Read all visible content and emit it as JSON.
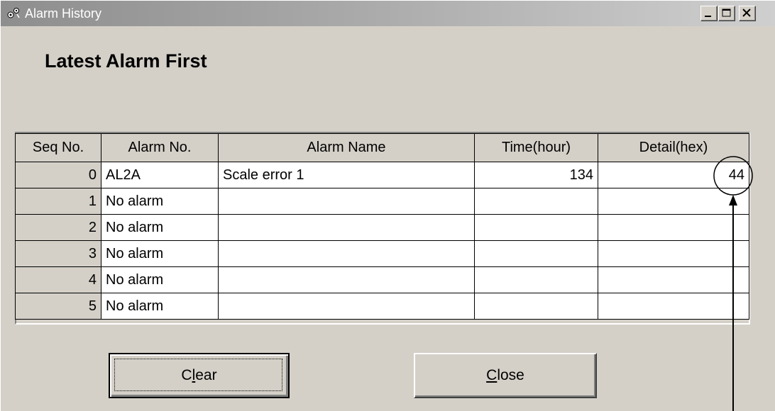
{
  "window": {
    "title": "Alarm History"
  },
  "heading": "Latest Alarm First",
  "table": {
    "columns": [
      "Seq No.",
      "Alarm No.",
      "Alarm Name",
      "Time(hour)",
      "Detail(hex)"
    ],
    "rows": [
      {
        "seq": "0",
        "alarm_no": "AL2A",
        "alarm_name": "Scale error 1",
        "time": "134",
        "detail": "44"
      },
      {
        "seq": "1",
        "alarm_no": "No alarm",
        "alarm_name": "",
        "time": "",
        "detail": ""
      },
      {
        "seq": "2",
        "alarm_no": "No alarm",
        "alarm_name": "",
        "time": "",
        "detail": ""
      },
      {
        "seq": "3",
        "alarm_no": "No alarm",
        "alarm_name": "",
        "time": "",
        "detail": ""
      },
      {
        "seq": "4",
        "alarm_no": "No alarm",
        "alarm_name": "",
        "time": "",
        "detail": ""
      },
      {
        "seq": "5",
        "alarm_no": "No alarm",
        "alarm_name": "",
        "time": "",
        "detail": ""
      }
    ]
  },
  "buttons": {
    "clear": {
      "before": "C",
      "mnemonic": "l",
      "after": "ear"
    },
    "close": {
      "before": "",
      "mnemonic": "C",
      "after": "lose"
    }
  },
  "icons": {
    "app": "alarm-history-app-icon",
    "minimize": "minimize-icon",
    "maximize": "maximize-icon",
    "close": "close-icon"
  },
  "colors": {
    "face": "#d4d0c8",
    "title_start": "#8e8e8e",
    "title_end": "#cfcfcf"
  }
}
